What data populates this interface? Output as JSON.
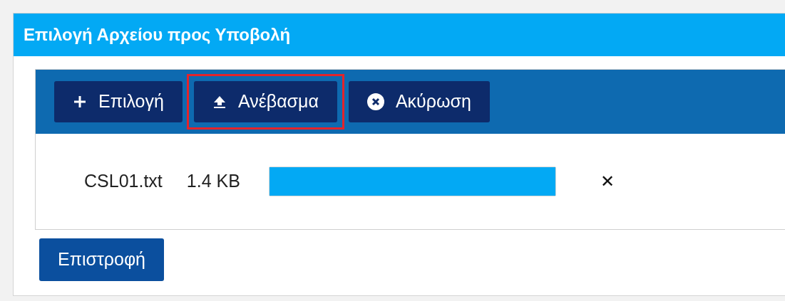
{
  "panel": {
    "title": "Επιλογή Αρχείου προς Υποβολή"
  },
  "toolbar": [
    {
      "kind": "add",
      "label": "Επιλογή",
      "highlighted": false
    },
    {
      "kind": "upload",
      "label": "Ανέβασμα",
      "highlighted": true
    },
    {
      "kind": "cancel",
      "label": "Ακύρωση",
      "highlighted": false
    }
  ],
  "files": [
    {
      "name": "CSL01.txt",
      "size": "1.4 KB",
      "level": 1,
      "remove": "✕"
    }
  ],
  "back_button": "Επιστροφή"
}
